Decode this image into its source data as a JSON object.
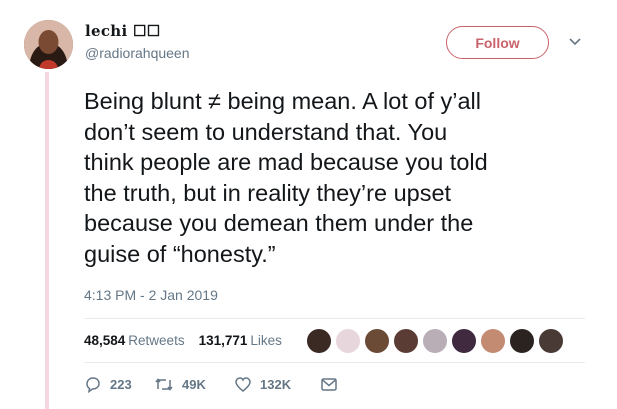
{
  "user": {
    "display_name": "lechi ☐☐",
    "handle": "@radiorahqueen"
  },
  "follow_label": "Follow",
  "tweet": {
    "lines": [
      "Being blunt ≠ being mean. A lot of y’all",
      "don’t seem to understand that. You",
      "think people are mad because you told",
      "the truth, but in reality they’re upset",
      "because you demean them under the",
      "guise of “honesty.”"
    ],
    "timestamp": "4:13 PM - 2 Jan 2019"
  },
  "stats": {
    "retweets_count": "48,584",
    "retweets_label": "Retweets",
    "likes_count": "131,771",
    "likes_label": "Likes"
  },
  "actions": {
    "reply_count": "223",
    "retweet_count": "49K",
    "like_count": "132K"
  },
  "colors": {
    "accent": "#c9636b",
    "thread_line": "#f6d7e0",
    "muted_text": "#657786"
  },
  "icons": [
    "reply-icon",
    "retweet-icon",
    "like-icon",
    "message-icon",
    "caret-down-icon"
  ]
}
